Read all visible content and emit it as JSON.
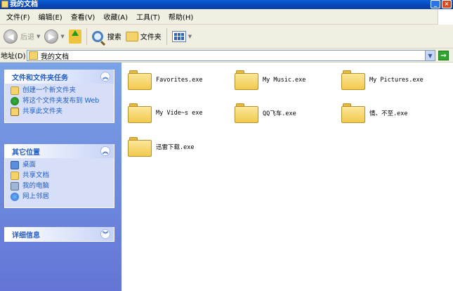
{
  "window": {
    "title": "我的文档"
  },
  "menu": [
    "文件(F)",
    "编辑(E)",
    "查看(V)",
    "收藏(A)",
    "工具(T)",
    "帮助(H)"
  ],
  "toolbar": {
    "back": "后退",
    "search": "搜索",
    "folders": "文件夹"
  },
  "address": {
    "label": "地址(D)",
    "value": "我的文档"
  },
  "panels": {
    "tasks": {
      "title": "文件和文件夹任务",
      "items": [
        "创建一个新文件夹",
        "将这个文件夹发布到 Web",
        "共享此文件夹"
      ]
    },
    "places": {
      "title": "其它位置",
      "items": [
        "桌面",
        "共享文档",
        "我的电脑",
        "网上邻居"
      ]
    },
    "details": {
      "title": "详细信息"
    }
  },
  "files": [
    "Favorites.exe",
    "My Music.exe",
    "My Pictures.exe",
    "My Vide~s exe",
    "QQ飞车.exe",
    "情、不至.exe",
    "迅雷下载.exe"
  ],
  "colors": {
    "titlebar": "#0846b4",
    "taskpane": "#6f8de0",
    "link": "#215dc6"
  }
}
